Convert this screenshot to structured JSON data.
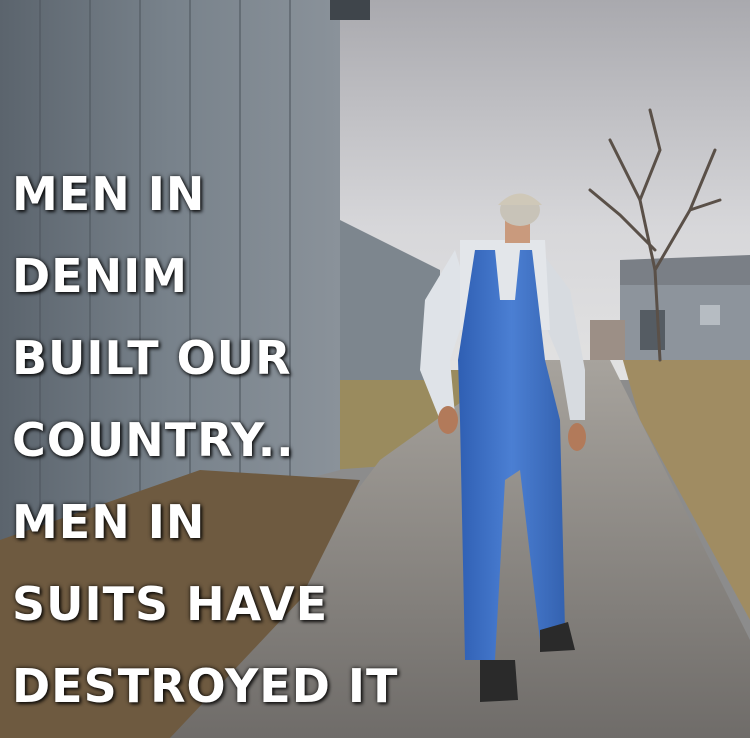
{
  "caption": {
    "lines": [
      "MEN IN",
      "DENIM",
      "BUILT OUR",
      "COUNTRY..",
      "MEN IN",
      "SUITS HAVE",
      "DESTROYED IT"
    ]
  },
  "colors": {
    "sky": "#c9c9cc",
    "barn_wall": "#6f7880",
    "overalls": "#3f6fc4",
    "shirt": "#dfe3e8",
    "road": "#8a8784",
    "grass": "#8c7a55",
    "caption_text": "#ffffff"
  }
}
